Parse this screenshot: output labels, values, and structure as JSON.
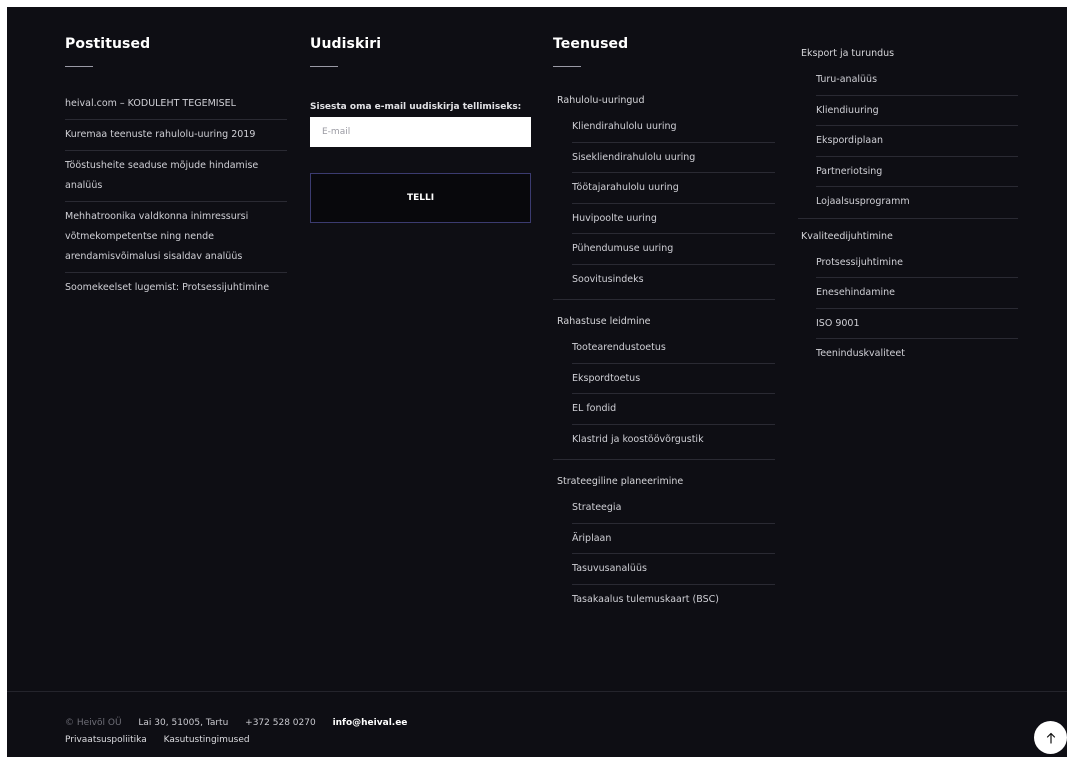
{
  "posts": {
    "title": "Postitused",
    "items": [
      "heival.com – KODULEHT TEGEMISEL",
      "Kuremaa teenuste rahulolu-uuring 2019",
      "Tööstusheite seaduse mõjude hindamise analüüs",
      "Mehhatroonika valdkonna inimressursi võtmekompetentse ning nende arendamisvõimalusi sisaldav analüüs",
      "Soomekeelset lugemist: Protsessijuhtimine"
    ]
  },
  "newsletter": {
    "title": "Uudiskiri",
    "prompt": "Sisesta oma e-mail uudiskirja tellimiseks:",
    "email_placeholder": "E-mail",
    "submit_label": "TELLI"
  },
  "services": {
    "title": "Teenused",
    "groups": [
      {
        "label": "Rahulolu-uuringud",
        "items": [
          "Kliendirahulolu uuring",
          "Sisekliendirahulolu uuring",
          "Töötajarahulolu uuring",
          "Huvipoolte uuring",
          "Pühendumuse uuring",
          "Soovitusindeks"
        ]
      },
      {
        "label": "Rahastuse leidmine",
        "items": [
          "Tootearendustoetus",
          "Ekspordtoetus",
          "EL fondid",
          "Klastrid ja koostöövõrgustik"
        ]
      },
      {
        "label": "Strateegiline planeerimine",
        "items": [
          "Strateegia",
          "Äriplaan",
          "Tasuvusanalüüs",
          "Tasakaalus tulemuskaart (BSC)"
        ]
      }
    ]
  },
  "services_extra": {
    "groups": [
      {
        "label": "Eksport ja turundus",
        "items": [
          "Turu-analüüs",
          "Kliendiuuring",
          "Ekspordiplaan",
          "Partneriotsing",
          "Lojaalsusprogramm"
        ]
      },
      {
        "label": "Kvaliteedijuhtimine",
        "items": [
          "Protsessijuhtimine",
          "Enesehindamine",
          "ISO 9001",
          "Teeninduskvaliteet"
        ]
      }
    ]
  },
  "footer": {
    "copyright": "© Heivõl OÜ",
    "address": "Lai 30, 51005, Tartu",
    "phone": "+372 528 0270",
    "email": "info@heival.ee",
    "privacy": "Privaatsuspoliitika",
    "terms": "Kasutustingimused"
  },
  "icons": {
    "scroll_top": "arrow-up-icon"
  },
  "colors": {
    "background": "#0e0e14",
    "button_border": "#3b3b70",
    "text": "#d6d6da"
  }
}
